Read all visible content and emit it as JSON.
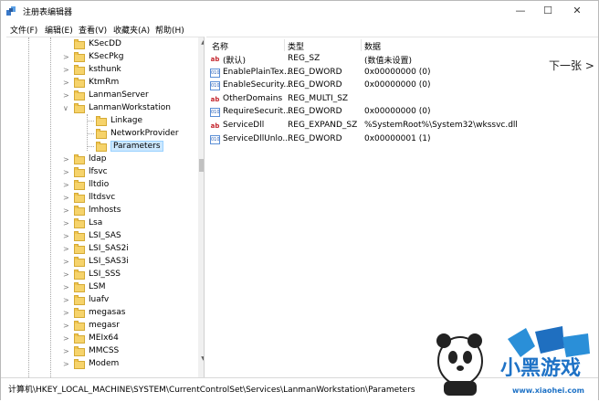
{
  "window": {
    "title": "注册表编辑器"
  },
  "menu": [
    "文件(F)",
    "编辑(E)",
    "查看(V)",
    "收藏夹(A)",
    "帮助(H)"
  ],
  "tree": [
    {
      "label": "KSecDD",
      "arrow": ""
    },
    {
      "label": "KSecPkg",
      "arrow": ">"
    },
    {
      "label": "ksthunk",
      "arrow": ">"
    },
    {
      "label": "KtmRm",
      "arrow": ">"
    },
    {
      "label": "LanmanServer",
      "arrow": ">"
    },
    {
      "label": "LanmanWorkstation",
      "arrow": "v"
    },
    {
      "label": "Linkage",
      "arrow": "",
      "child": true
    },
    {
      "label": "NetworkProvider",
      "arrow": "",
      "child": true
    },
    {
      "label": "Parameters",
      "arrow": "",
      "child": true,
      "selected": true
    },
    {
      "label": "ldap",
      "arrow": ">"
    },
    {
      "label": "lfsvc",
      "arrow": ">"
    },
    {
      "label": "lltdio",
      "arrow": ">"
    },
    {
      "label": "lltdsvc",
      "arrow": ">"
    },
    {
      "label": "lmhosts",
      "arrow": ">"
    },
    {
      "label": "Lsa",
      "arrow": ">"
    },
    {
      "label": "LSI_SAS",
      "arrow": ">"
    },
    {
      "label": "LSI_SAS2i",
      "arrow": ">"
    },
    {
      "label": "LSI_SAS3i",
      "arrow": ">"
    },
    {
      "label": "LSI_SSS",
      "arrow": ">"
    },
    {
      "label": "LSM",
      "arrow": ">"
    },
    {
      "label": "luafv",
      "arrow": ">"
    },
    {
      "label": "megasas",
      "arrow": ">"
    },
    {
      "label": "megasr",
      "arrow": ">"
    },
    {
      "label": "MEIx64",
      "arrow": ">"
    },
    {
      "label": "MMCSS",
      "arrow": ">"
    },
    {
      "label": "Modem",
      "arrow": ">"
    }
  ],
  "columns": {
    "name": "名称",
    "type": "类型",
    "data": "数据"
  },
  "values": [
    {
      "icon": "ab",
      "kind": "sz",
      "name": "(默认)",
      "type": "REG_SZ",
      "data": "(数值未设置)"
    },
    {
      "icon": "010",
      "kind": "bin",
      "name": "EnablePlainTex...",
      "type": "REG_DWORD",
      "data": "0x00000000 (0)"
    },
    {
      "icon": "010",
      "kind": "bin",
      "name": "EnableSecurity...",
      "type": "REG_DWORD",
      "data": "0x00000000 (0)"
    },
    {
      "icon": "ab",
      "kind": "sz",
      "name": "OtherDomains",
      "type": "REG_MULTI_SZ",
      "data": ""
    },
    {
      "icon": "010",
      "kind": "bin",
      "name": "RequireSecurit...",
      "type": "REG_DWORD",
      "data": "0x00000000 (0)"
    },
    {
      "icon": "ab",
      "kind": "sz",
      "name": "ServiceDll",
      "type": "REG_EXPAND_SZ",
      "data": "%SystemRoot%\\System32\\wkssvc.dll"
    },
    {
      "icon": "010",
      "kind": "bin",
      "name": "ServiceDllUnlo...",
      "type": "REG_DWORD",
      "data": "0x00000001 (1)"
    }
  ],
  "status": {
    "path": "计算机\\HKEY_LOCAL_MACHINE\\SYSTEM\\CurrentControlSet\\Services\\LanmanWorkstation\\Parameters"
  },
  "overlay": {
    "next_label": "下一张",
    "next_arrow": ">"
  },
  "watermark": {
    "brand": "小黑游戏",
    "url": "www.xiaohei.com"
  }
}
